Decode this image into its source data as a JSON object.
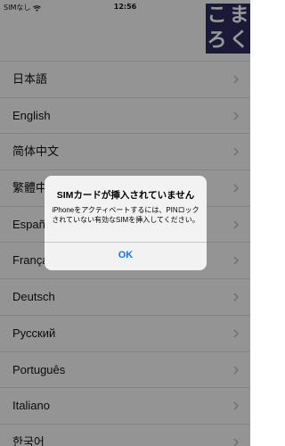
{
  "status_bar": {
    "carrier": "SIMなし",
    "time": "12:56"
  },
  "logo": {
    "chars": [
      "こ",
      "ま",
      "ろ",
      "く"
    ]
  },
  "languages": [
    {
      "label": "日本語"
    },
    {
      "label": "English"
    },
    {
      "label": "简体中文"
    },
    {
      "label": "繁體中文"
    },
    {
      "label": "Español"
    },
    {
      "label": "Français"
    },
    {
      "label": "Deutsch"
    },
    {
      "label": "Русский"
    },
    {
      "label": "Português"
    },
    {
      "label": "Italiano"
    },
    {
      "label": "한국어"
    }
  ],
  "alert": {
    "title": "SIMカードが挿入されていません",
    "message": "iPhoneをアクティベートするには、PINロックされていない有効なSIMを挿入してください。",
    "ok_label": "OK"
  },
  "colors": {
    "accent": "#1a73e8",
    "logo_bg": "#2d2b5e"
  }
}
